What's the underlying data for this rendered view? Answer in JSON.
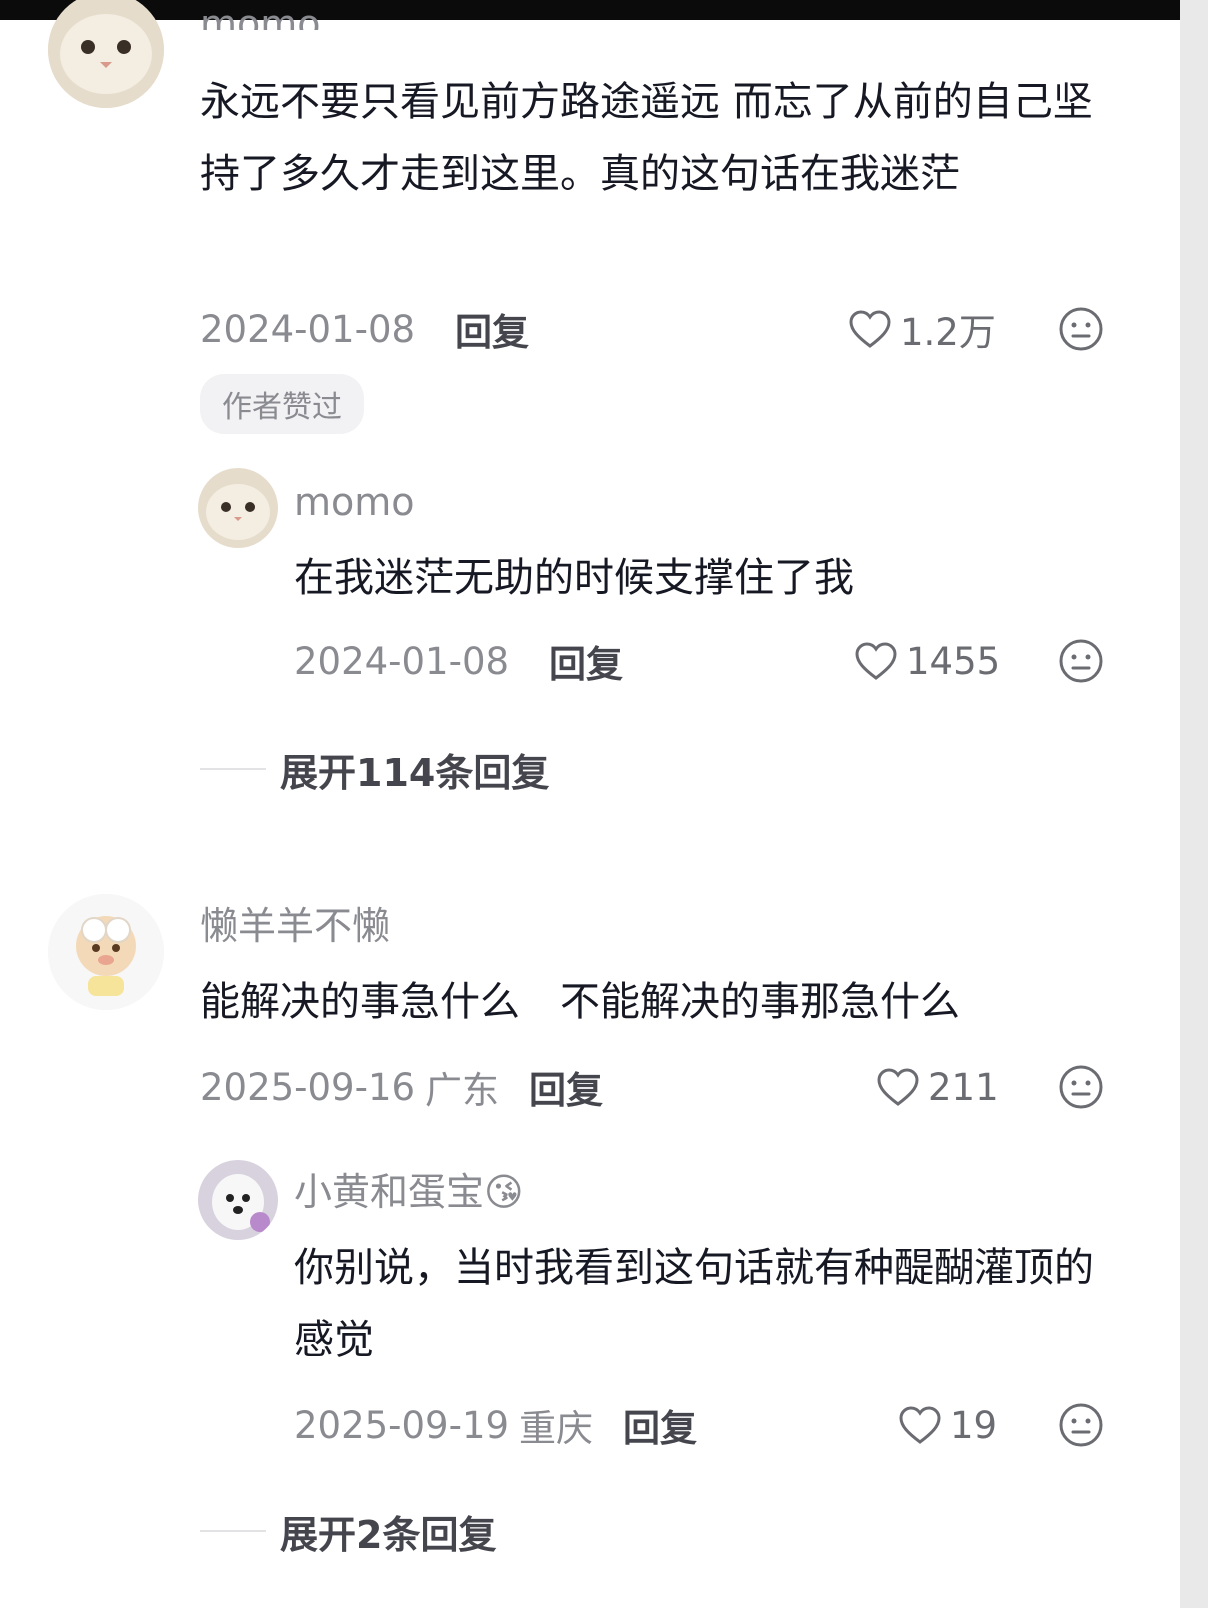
{
  "comments": [
    {
      "username": "momo",
      "text": "永远不要只看见前方路途遥远 而忘了从前的自己坚持了多久才走到这里。真的这句话在我迷茫",
      "date": "2024-01-08",
      "location": "",
      "reply_label": "回复",
      "likes": "1.2万",
      "badge": "作者赞过"
    },
    {
      "username": "momo",
      "text": "在我迷茫无助的时候支撑住了我",
      "date": "2024-01-08",
      "location": "",
      "reply_label": "回复",
      "likes": "1455"
    },
    {
      "expand_label": "展开114条回复"
    },
    {
      "username": "懒羊羊不懒",
      "text": "能解决的事急什么　不能解决的事那急什么",
      "date": "2025-09-16",
      "location": "广东",
      "reply_label": "回复",
      "likes": "211"
    },
    {
      "username": "小黄和蛋宝😘",
      "text": "你别说，当时我看到这句话就有种醍醐灌顶的感觉",
      "date": "2025-09-19",
      "location": "重庆",
      "reply_label": "回复",
      "likes": "19"
    },
    {
      "expand_label": "展开2条回复"
    }
  ],
  "icons": {
    "like": "heart-outline-icon",
    "emoji": "emoji-face-icon"
  },
  "colors": {
    "text_primary": "#161823",
    "text_secondary": "#8a8b91",
    "badge_bg": "#f2f2f4"
  }
}
